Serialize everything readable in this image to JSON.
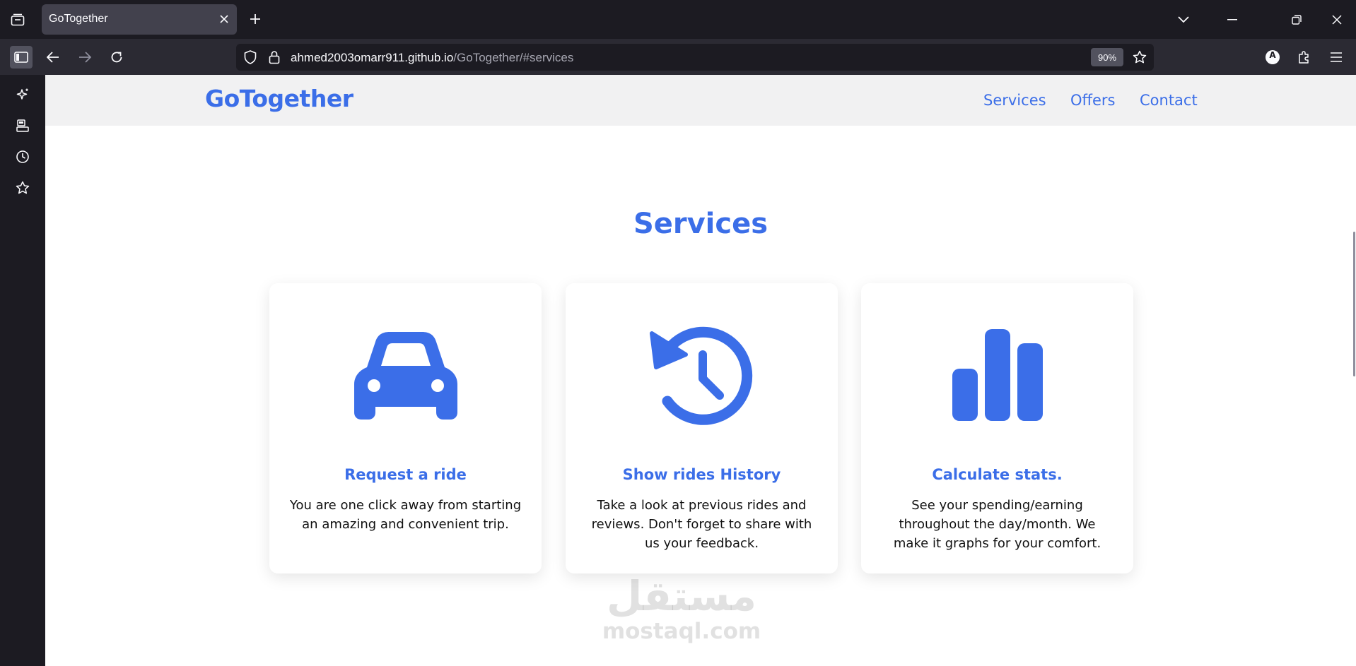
{
  "browser": {
    "tab_title": "GoTogether",
    "url_host": "ahmed2003omarr911.github.io",
    "url_path": "/GoTogether/#services",
    "zoom": "90%",
    "account_initial": "A"
  },
  "site": {
    "brand": "GoTogether",
    "nav": [
      "Services",
      "Offers",
      "Contact"
    ],
    "section_title": "Services",
    "cards": [
      {
        "icon": "car-icon",
        "title": "Request a ride",
        "text": "You are one click away from starting an amazing and convenient trip."
      },
      {
        "icon": "history-icon",
        "title": "Show rides History",
        "text": "Take a look at previous rides and reviews. Don't forget to share with us your feedback."
      },
      {
        "icon": "bar-chart-icon",
        "title": "Calculate stats.",
        "text": "See your spending/earning throughout the day/month. We make it graphs for your comfort."
      }
    ],
    "accent_color": "#3b6ee8"
  },
  "watermark": {
    "arabic": "مستقل",
    "latin": "mostaql.com"
  }
}
